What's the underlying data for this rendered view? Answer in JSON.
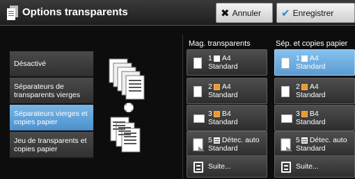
{
  "header": {
    "title": "Options transparents",
    "title_icon": "document-icon",
    "cancel_label": "Annuler",
    "cancel_glyph": "✖",
    "save_label": "Enregistrer",
    "save_glyph": "✔"
  },
  "options": [
    {
      "label": "Désactivé",
      "selected": false
    },
    {
      "label": "Séparateurs de transparents vierges",
      "selected": false
    },
    {
      "label": "Séparateurs vierges et copies papier",
      "selected": true
    },
    {
      "label": "Jeu de transparents et copies papier",
      "selected": false
    }
  ],
  "columns": {
    "transparents_header": "Mag. transparents",
    "papier_header": "Sép. et copies papier"
  },
  "trays_transparents": [
    {
      "num": "1",
      "size": "A4",
      "type": "Standard",
      "selected": false
    },
    {
      "num": "2",
      "size": "A4",
      "type": "Standard",
      "selected": false
    },
    {
      "num": "3",
      "size": "B4",
      "type": "Standard",
      "selected": false
    },
    {
      "num": "5",
      "size": "Détec. auto",
      "type": "Standard",
      "selected": false
    }
  ],
  "trays_papier": [
    {
      "num": "1",
      "size": "A4",
      "type": "Standard",
      "selected": true
    },
    {
      "num": "2",
      "size": "A4",
      "type": "Standard",
      "selected": false
    },
    {
      "num": "3",
      "size": "B4",
      "type": "Standard",
      "selected": false
    },
    {
      "num": "5",
      "size": "Détec. auto",
      "type": "Standard",
      "selected": false
    }
  ],
  "more_label": "Suite...",
  "colors": {
    "selected": "#5a9bd3",
    "tray_icon_orange": "#e79a2c"
  }
}
